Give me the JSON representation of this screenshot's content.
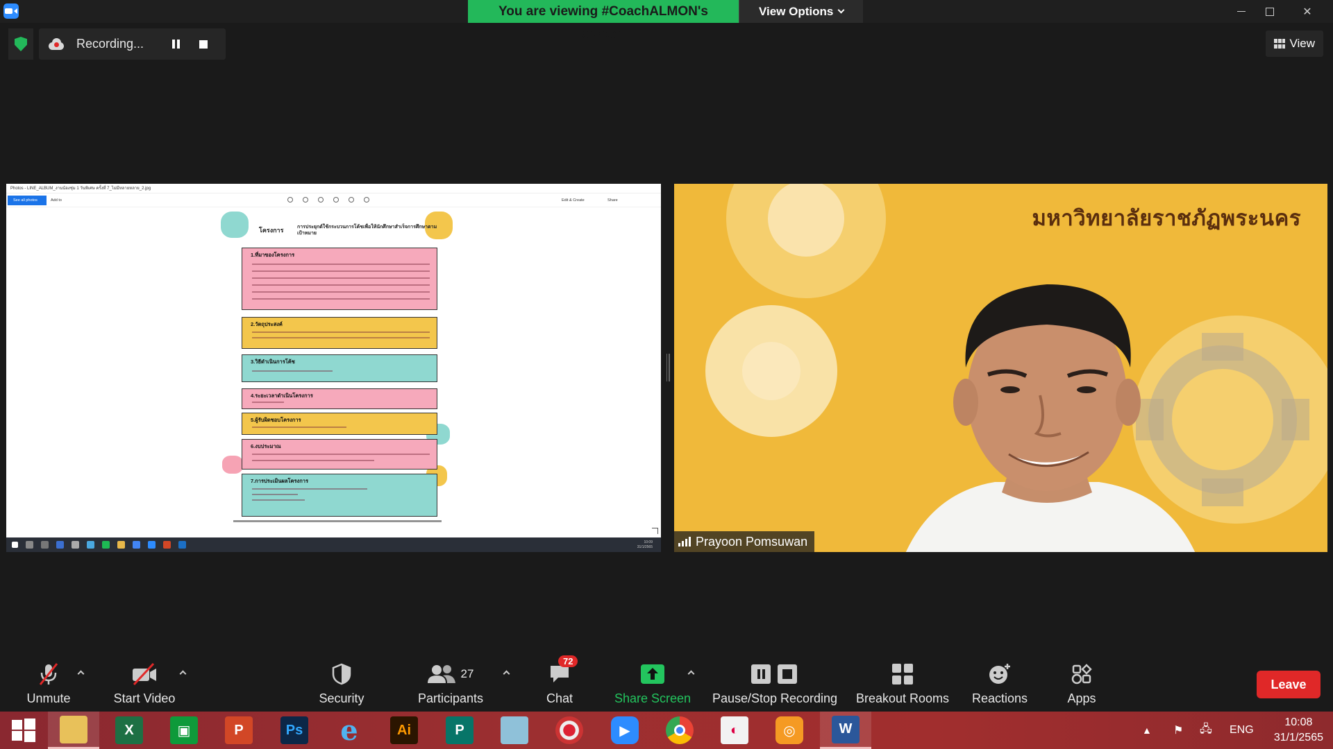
{
  "titlebar": {
    "viewing_text": "You are viewing #CoachALMON's screen",
    "view_options_label": "View Options"
  },
  "recording": {
    "label": "Recording..."
  },
  "view_button_label": "View",
  "shared_screen": {
    "window_title": "Photos - LINE_ALBUM_งานน้องชุ่ม 1 วันพิเศษ ครั้งที่ 7_ไม่มีหลายหลาย_2.jpg",
    "see_all_label": "See all photos",
    "add_to_label": "Add to",
    "edit_create_label": "Edit & Create",
    "share_label": "Share",
    "poster": {
      "title": "โครงการ",
      "subtitle": "การประยุกต์ใช้กระบวนการโค้ชเพื่อให้นักศึกษาสำเร็จการศึกษาตามเป้าหมาย",
      "sections": [
        "1.ที่มาของโครงการ",
        "2.วัตถุประสงค์",
        "3.วิธีดำเนินการโค้ช",
        "4.ระยะเวลาดำเนินโครงการ",
        "5.ผู้รับผิดชอบโครงการ",
        "6.งบประมาณ",
        "7.การประเมินผลโครงการ"
      ]
    },
    "inner_clock": {
      "time": "10:09",
      "date": "31/1/2565"
    }
  },
  "video": {
    "background_text": "มหาวิทยาลัยราชภัฏพระนคร",
    "participant_name": "Prayoon Pomsuwan"
  },
  "controls": {
    "unmute": "Unmute",
    "start_video": "Start Video",
    "security": "Security",
    "participants": "Participants",
    "participants_count": "27",
    "chat": "Chat",
    "chat_badge": "72",
    "share_screen": "Share Screen",
    "pause_stop_recording": "Pause/Stop Recording",
    "breakout_rooms": "Breakout Rooms",
    "reactions": "Reactions",
    "apps": "Apps",
    "leave": "Leave"
  },
  "taskbar": {
    "language": "ENG",
    "time": "10:08",
    "date": "31/1/2565"
  },
  "colors": {
    "zoom_green": "#23b85a",
    "leave_red": "#e02828",
    "zoom_blue": "#2d8cff",
    "video_bg": "#f0b93a"
  }
}
